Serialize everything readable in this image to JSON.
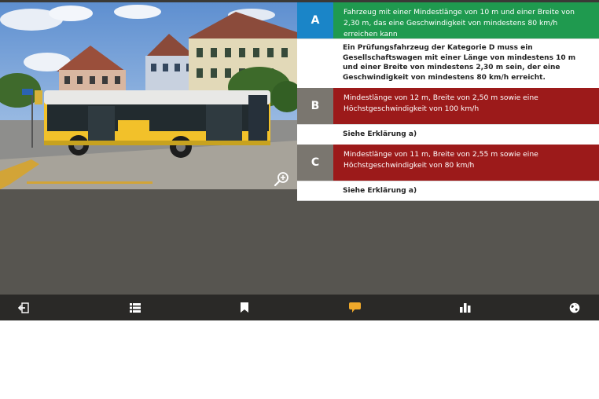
{
  "photo": {
    "alt_name": "postbus-photo",
    "zoom_icon": "zoom-in-icon"
  },
  "answers": [
    {
      "letter": "A",
      "text": "Fahrzeug mit einer Mindestlänge von 10 m und einer Breite von 2,30 m, das eine Geschwindigkeit von mindestens 80 km/h erreichen kann",
      "state": "correct",
      "explanation": "Ein Prüfungsfahrzeug der Kategorie D muss ein Gesellschaftswagen mit einer Länge von mindestens 10 m und einer Breite von mindestens 2,30 m sein, der eine Geschwindigkeit von mindestens 80 km/h erreicht."
    },
    {
      "letter": "B",
      "text": "Mindestlänge von 12 m, Breite von 2,50 m sowie eine Höchstgeschwindigkeit von 100 km/h",
      "state": "wrong",
      "explanation": "Siehe Erklärung a)"
    },
    {
      "letter": "C",
      "text": "Mindestlänge von 11 m, Breite von 2,55 m sowie eine Höchstgeschwindigkeit von 80 km/h",
      "state": "wrong",
      "explanation": "Siehe Erklärung a)"
    }
  ],
  "colors": {
    "correct": "#1f9a4f",
    "wrong": "#9c1a1a",
    "letter_correct": "#1a85c8",
    "letter_neutral": "#7a766f",
    "toolbar": "#2a2927",
    "comment_icon": "#f0a92a"
  },
  "toolbar": {
    "icons": [
      "exit-icon",
      "list-icon",
      "bookmark-icon",
      "comment-icon",
      "statistics-icon",
      "language-globe-icon"
    ]
  }
}
